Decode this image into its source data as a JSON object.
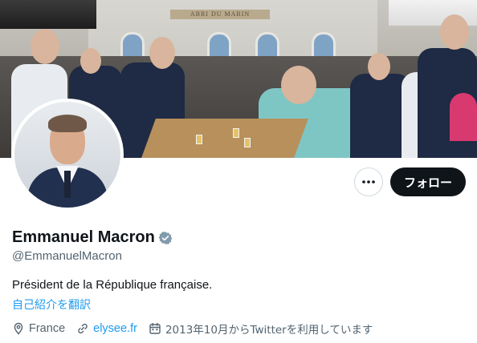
{
  "banner": {
    "sign_text": "ABRI DU MARIN"
  },
  "actions": {
    "more_icon": "more-horizontal-icon",
    "follow_label": "フォロー"
  },
  "profile": {
    "display_name": "Emmanuel Macron",
    "verified_icon": "verified-badge-icon",
    "verified_color": "#829aab",
    "handle": "@EmmanuelMacron",
    "bio": "Président de la République française.",
    "translate_link": "自己紹介を翻訳",
    "location": "France",
    "location_icon": "location-pin-icon",
    "website": "elysee.fr",
    "website_icon": "link-icon",
    "joined": "2013年10月からTwitterを利用しています",
    "joined_icon": "calendar-icon"
  },
  "colors": {
    "link": "#1d9bf0",
    "secondary_text": "#536471",
    "primary_text": "#0f1419",
    "follow_button_bg": "#0f1419"
  }
}
